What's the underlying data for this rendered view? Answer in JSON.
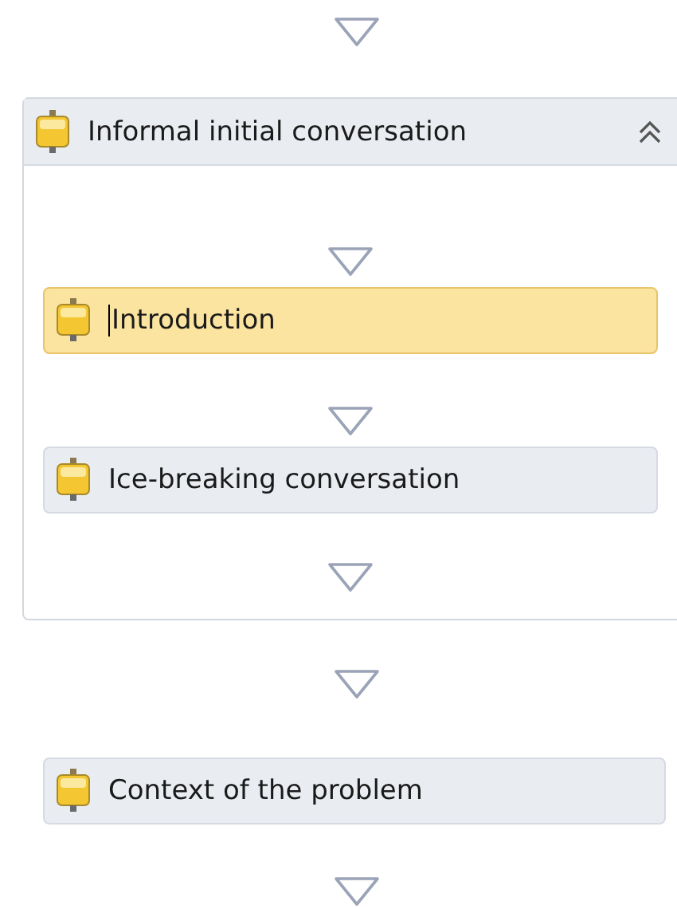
{
  "sequence": {
    "title": "Informal initial conversation",
    "expanded": true,
    "activities": [
      {
        "label": "Introduction",
        "selected": true,
        "editing": true
      },
      {
        "label": "Ice-breaking conversation",
        "selected": false,
        "editing": false
      }
    ]
  },
  "activities": [
    {
      "label": "Context of the problem",
      "selected": false,
      "editing": false
    }
  ]
}
